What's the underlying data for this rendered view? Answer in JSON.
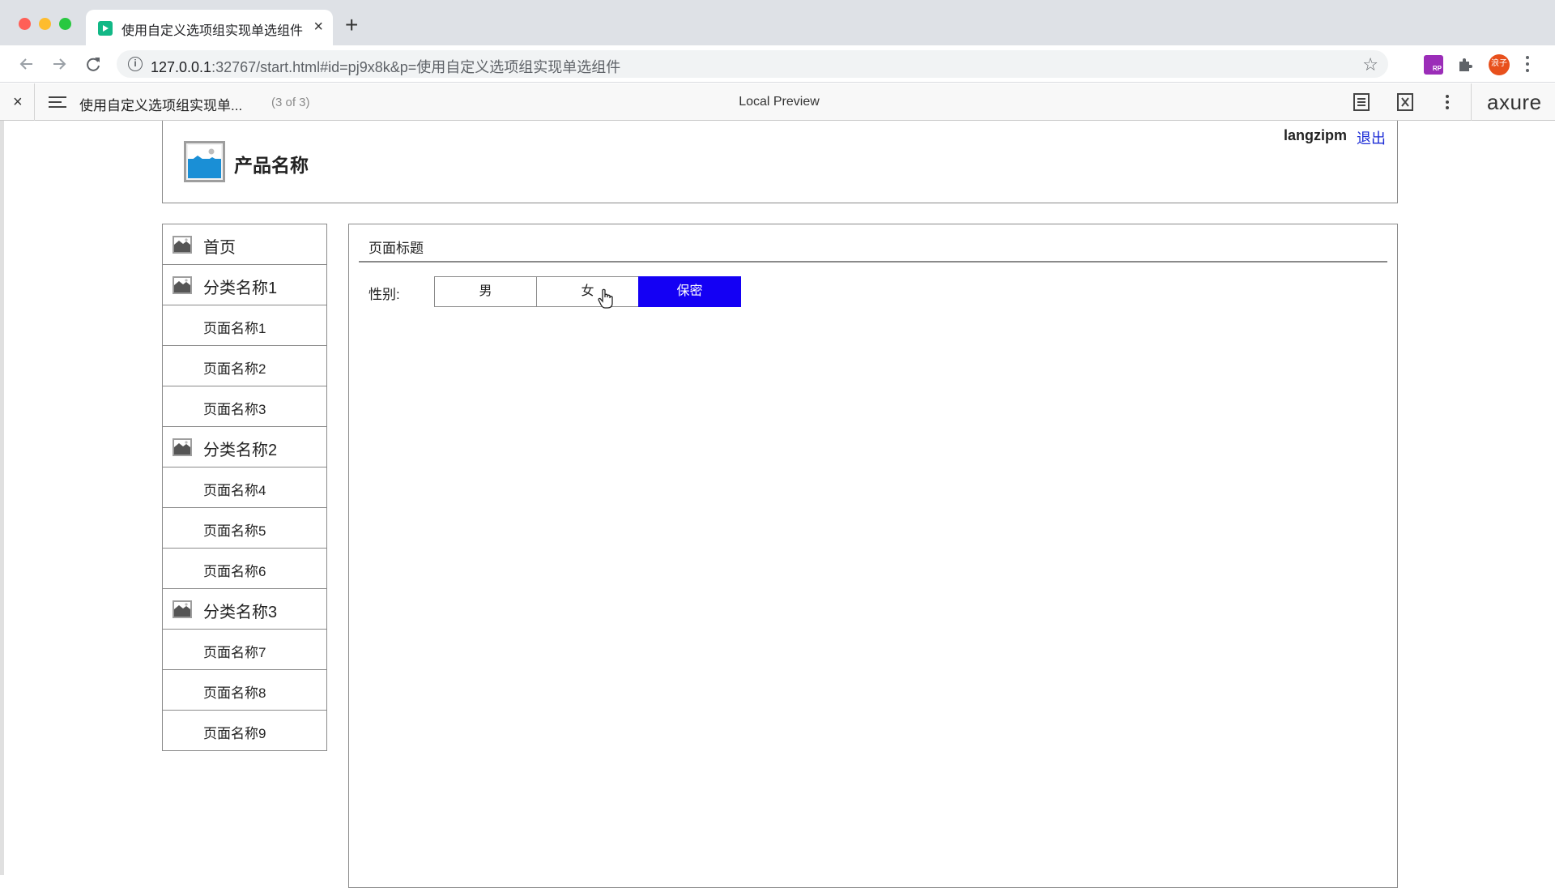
{
  "browser": {
    "tab_title": "使用自定义选项组实现单选组件",
    "tab_close": "×",
    "new_tab": "+",
    "url_host": "127.0.0.1",
    "url_rest": ":32767/start.html#id=pj9x8k&p=使用自定义选项组实现单选组件",
    "info_icon": "i",
    "star": "☆",
    "ext_rp_label": "RP",
    "avatar_label": "浪子"
  },
  "axure_bar": {
    "close": "×",
    "page_title": "使用自定义选项组实现单...",
    "page_count": "(3 of 3)",
    "center_title": "Local Preview",
    "logo": "axure"
  },
  "header": {
    "product_name": "产品名称",
    "username": "langzipm",
    "logout": "退出"
  },
  "sidebar": {
    "items": [
      {
        "type": "category",
        "label": "首页"
      },
      {
        "type": "category",
        "label": "分类名称1"
      },
      {
        "type": "page",
        "label": "页面名称1"
      },
      {
        "type": "page",
        "label": "页面名称2"
      },
      {
        "type": "page",
        "label": "页面名称3"
      },
      {
        "type": "category",
        "label": "分类名称2"
      },
      {
        "type": "page",
        "label": "页面名称4"
      },
      {
        "type": "page",
        "label": "页面名称5"
      },
      {
        "type": "page",
        "label": "页面名称6"
      },
      {
        "type": "category",
        "label": "分类名称3"
      },
      {
        "type": "page",
        "label": "页面名称7"
      },
      {
        "type": "page",
        "label": "页面名称8"
      },
      {
        "type": "page",
        "label": "页面名称9"
      }
    ]
  },
  "main": {
    "page_heading": "页面标题",
    "gender_label": "性别:",
    "options": [
      {
        "label": "男",
        "selected": false
      },
      {
        "label": "女",
        "selected": false
      },
      {
        "label": "保密",
        "selected": true
      }
    ]
  },
  "colors": {
    "selected": "#1400f4",
    "logout_link": "#1b2bd6",
    "border": "#8a8a8a",
    "favicon": "#12b886"
  }
}
